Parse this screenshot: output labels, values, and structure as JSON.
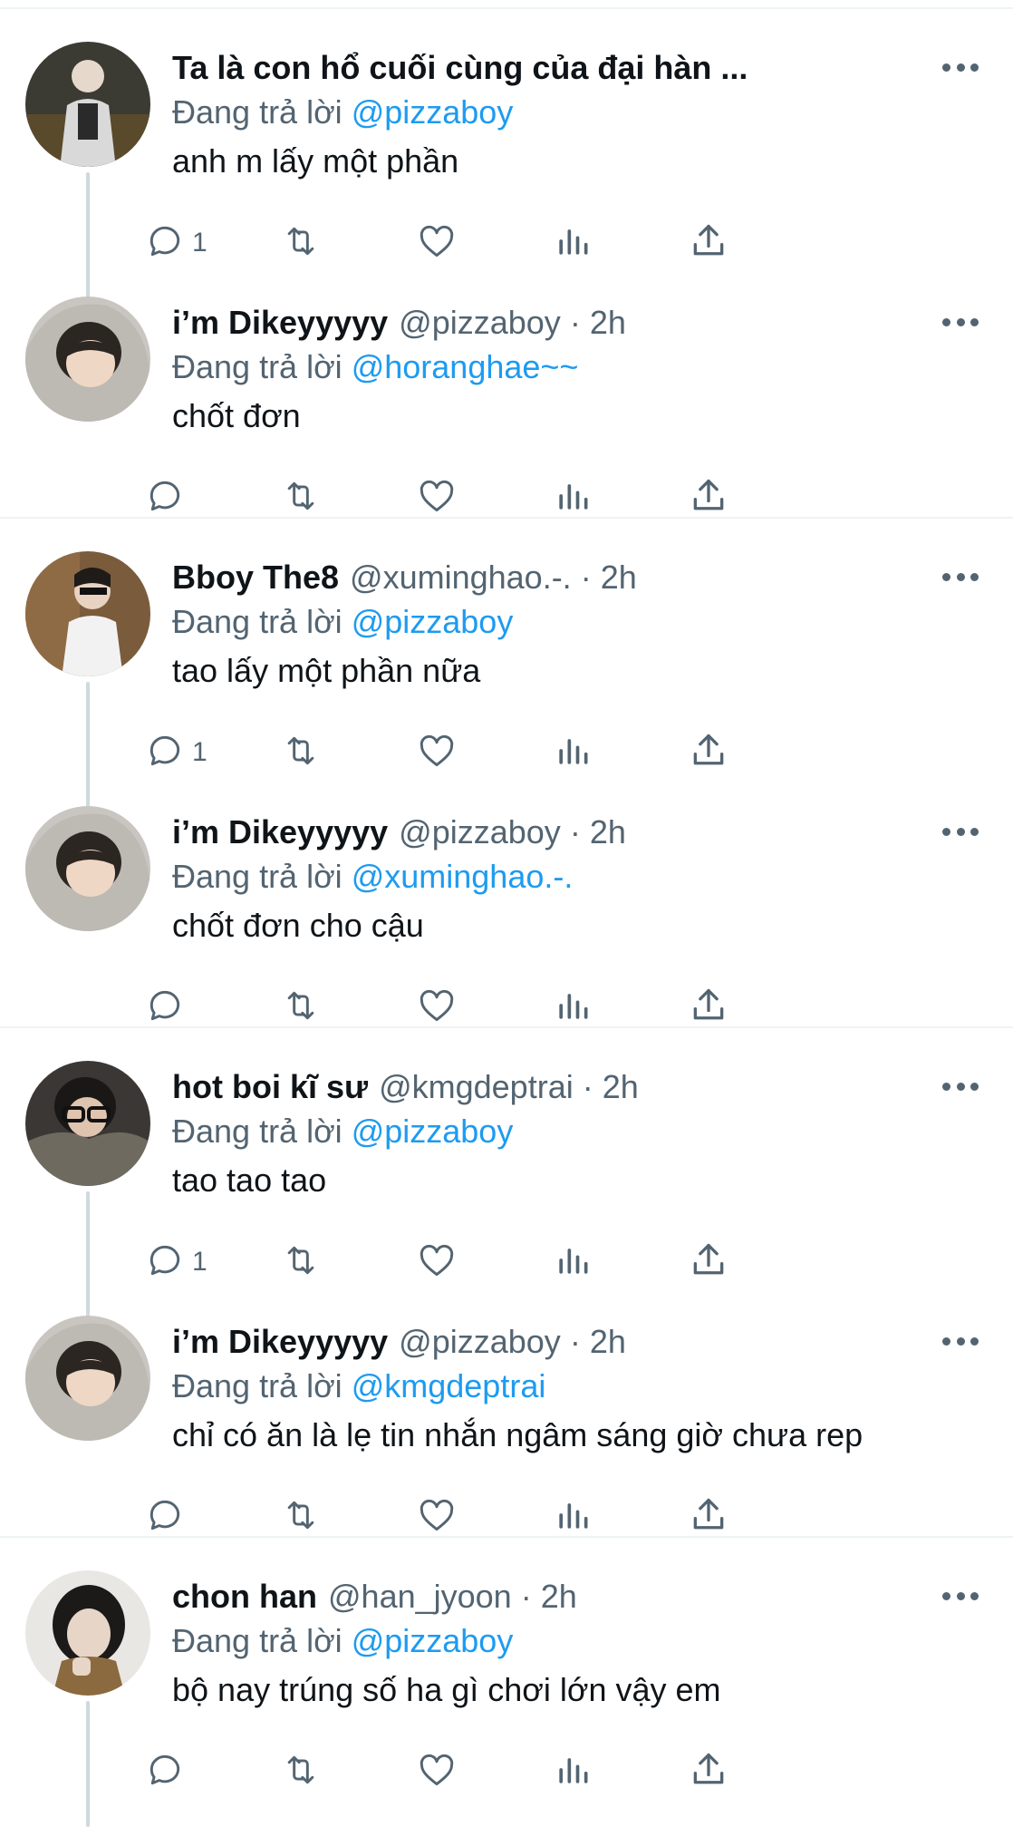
{
  "reply_prefix": "Đang trả lời",
  "threads": [
    {
      "tweets": [
        {
          "name": "Ta là con hổ cuối cùng của đại hàn ...",
          "handle": "",
          "time": "",
          "reply_to": "@pizzaboy",
          "text": "anh m lấy một phần",
          "reply_count": "1",
          "avatar": "avatar-1"
        },
        {
          "name": "i’m Dikeyyyyy",
          "handle": "@pizzaboy",
          "time": "2h",
          "reply_to": "@horanghae~~",
          "text": "chốt đơn",
          "reply_count": "",
          "avatar": "avatar-dikey"
        }
      ]
    },
    {
      "tweets": [
        {
          "name": "Bboy The8",
          "handle": "@xuminghao.-.",
          "time": "2h",
          "reply_to": "@pizzaboy",
          "text": "tao lấy một phần nữa",
          "reply_count": "1",
          "avatar": "avatar-the8"
        },
        {
          "name": "i’m Dikeyyyyy",
          "handle": "@pizzaboy",
          "time": "2h",
          "reply_to": "@xuminghao.-.",
          "text": "chốt đơn cho cậu",
          "reply_count": "",
          "avatar": "avatar-dikey"
        }
      ]
    },
    {
      "tweets": [
        {
          "name": "hot boi kĩ sư",
          "handle": "@kmgdeptrai",
          "time": "2h",
          "reply_to": "@pizzaboy",
          "text": "tao tao tao",
          "reply_count": "1",
          "avatar": "avatar-kmg"
        },
        {
          "name": "i’m Dikeyyyyy",
          "handle": "@pizzaboy",
          "time": "2h",
          "reply_to": "@kmgdeptrai",
          "text": "chỉ có ăn là lẹ tin nhắn ngâm sáng giờ chưa rep",
          "reply_count": "",
          "avatar": "avatar-dikey"
        }
      ]
    },
    {
      "tweets": [
        {
          "name": "chon han",
          "handle": "@han_jyoon",
          "time": "2h",
          "reply_to": "@pizzaboy",
          "text": "bộ nay trúng số ha gì chơi lớn vậy em",
          "reply_count": "",
          "avatar": "avatar-chonhan"
        }
      ]
    }
  ],
  "colors": {
    "text": "#0f1419",
    "secondary": "#536471",
    "link": "#1d9bf0",
    "divider": "#eff3f4",
    "connector": "#cfd9de"
  }
}
